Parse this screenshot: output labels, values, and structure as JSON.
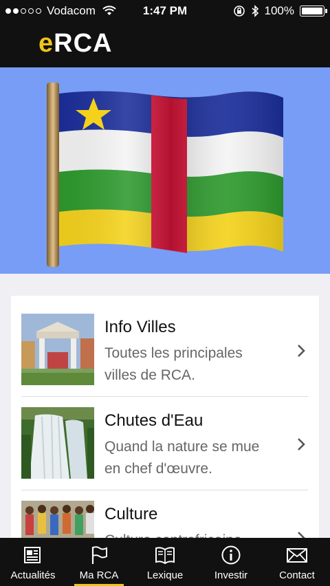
{
  "status": {
    "carrier": "Vodacom",
    "time": "1:47 PM",
    "battery": "100%"
  },
  "app": {
    "logo_e": "e",
    "logo_rest": "RCA"
  },
  "menu": [
    {
      "title": "Info Villes",
      "desc": "Toutes les principales villes de RCA.",
      "thumb": "city-gate-photo"
    },
    {
      "title": "Chutes d'Eau",
      "desc": "Quand la nature se mue en chef d'œuvre.",
      "thumb": "waterfall-photo"
    },
    {
      "title": "Culture",
      "desc": "Culture centrafricaine",
      "thumb": "crowd-photo"
    }
  ],
  "tabs": [
    {
      "label": "Actualités",
      "icon": "newspaper-icon",
      "active": false
    },
    {
      "label": "Ma RCA",
      "icon": "flag-icon",
      "active": true
    },
    {
      "label": "Lexique",
      "icon": "book-icon",
      "active": false
    },
    {
      "label": "Investir",
      "icon": "info-icon",
      "active": false
    },
    {
      "label": "Contact",
      "icon": "envelope-icon",
      "active": false
    }
  ],
  "colors": {
    "accent": "#f0c419",
    "hero_bg": "#779df6",
    "bar_bg": "#111111"
  }
}
